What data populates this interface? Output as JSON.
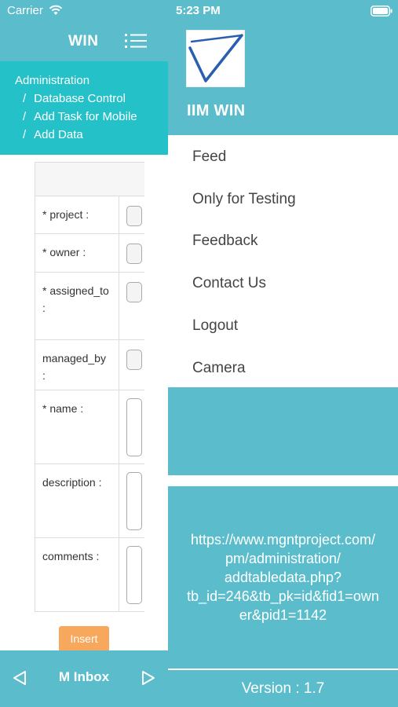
{
  "status_bar": {
    "carrier": "Carrier",
    "time": "5:23 PM"
  },
  "left_page": {
    "header": {
      "title": "WIN"
    },
    "breadcrumb": {
      "root": "Administration",
      "separator": "/",
      "items": [
        "Database Control",
        "Add Task for Mobile",
        "Add Data"
      ]
    },
    "form": {
      "rows": [
        {
          "label": "* project :"
        },
        {
          "label": "* owner :"
        },
        {
          "label": "* assigned_to :"
        },
        {
          "label": "managed_by :"
        },
        {
          "label": "* name :"
        },
        {
          "label": "description :"
        },
        {
          "label": "comments :"
        }
      ],
      "insert_label": "Insert"
    },
    "footer": {
      "inbox_label": "M Inbox"
    }
  },
  "drawer": {
    "app_title": "IIM WIN",
    "menu": [
      "Feed",
      "Only for Testing",
      "Feedback",
      "Contact Us",
      "Logout",
      "Camera"
    ],
    "url_lines": [
      "https://www.mgntproject.com/",
      "pm/administration/",
      "addtabledata.php?",
      "tb_id=246&tb_pk=id&fid1=own",
      "er&pid1=1142"
    ],
    "version": "Version : 1.7"
  },
  "colors": {
    "primary": "#5bbdcb",
    "breadcrumb_bg": "#24c2c8",
    "insert_button": "#f7a85c"
  },
  "icons": [
    "wifi-icon",
    "hamburger-menu-icon",
    "battery-icon",
    "logo-check-icon",
    "previous-arrow-icon",
    "next-arrow-icon"
  ]
}
